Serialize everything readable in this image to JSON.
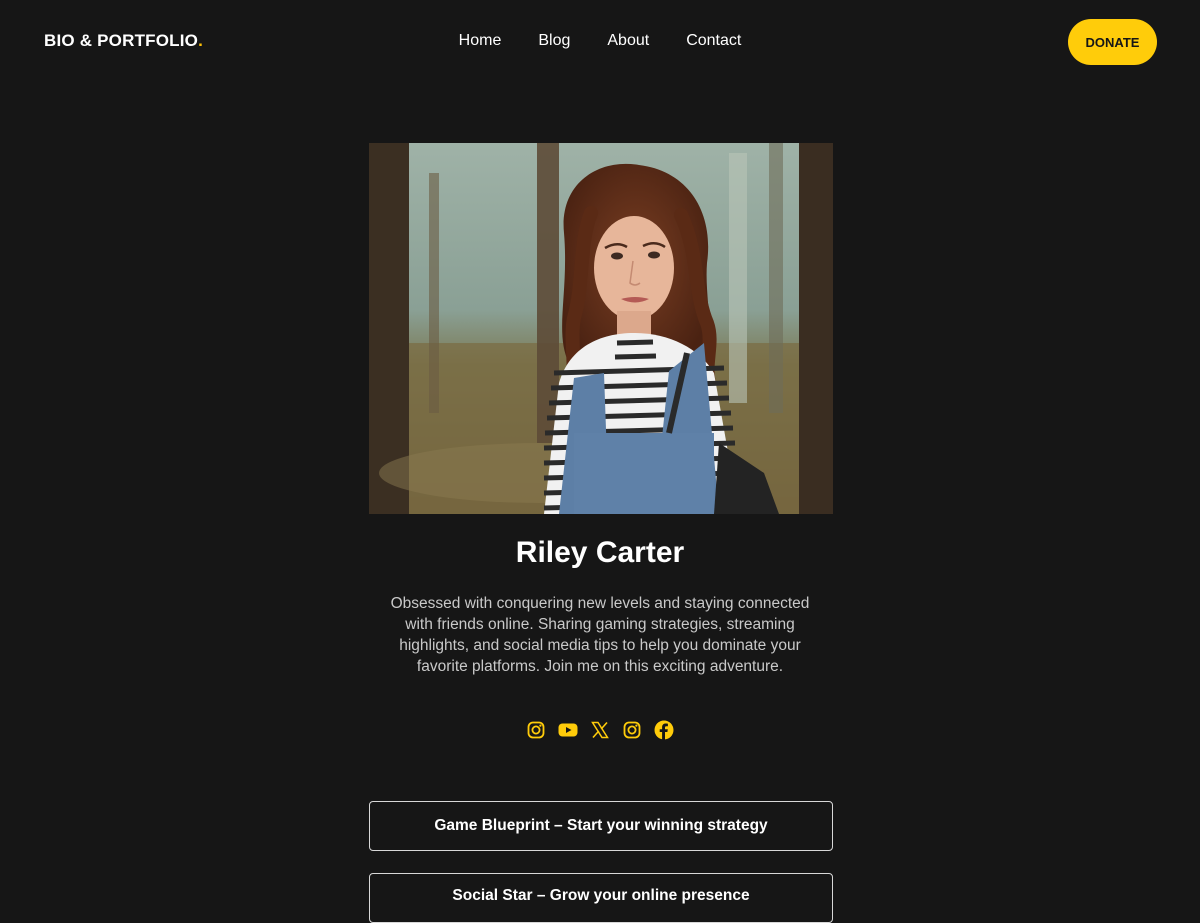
{
  "header": {
    "logo_text": "BIO & PORTFOLIO",
    "logo_dot": ".",
    "nav": [
      "Home",
      "Blog",
      "About",
      "Contact"
    ],
    "donate_label": "DONATE"
  },
  "profile": {
    "photo_alt": "Portrait photo",
    "name": "Riley Carter",
    "bio": "Obsessed with conquering new levels and staying connected with friends online. Sharing gaming strategies, streaming highlights, and social media tips to help you dominate your favorite platforms. Join me on this exciting adventure."
  },
  "social_icons": [
    "instagram-icon",
    "youtube-icon",
    "x-icon",
    "instagram-icon",
    "facebook-icon"
  ],
  "links": [
    "Game Blueprint – Start your winning strategy",
    "Social Star – Grow your online presence"
  ],
  "colors": {
    "background": "#161616",
    "accent": "#ffcc0a",
    "text": "#ffffff",
    "muted_text": "#c9c9c9"
  }
}
